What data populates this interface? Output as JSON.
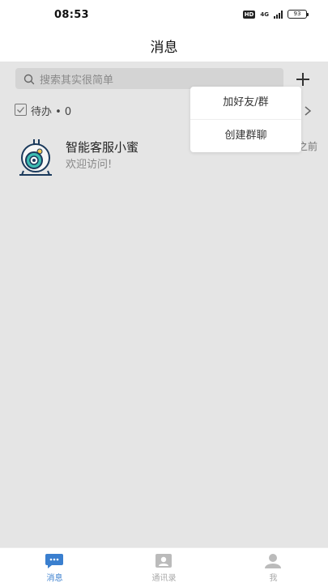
{
  "status_bar": {
    "time": "08:53",
    "hd": "HD",
    "network": "4G",
    "battery": "93"
  },
  "header": {
    "title": "消息"
  },
  "search": {
    "placeholder": "搜索其实很简单"
  },
  "todo": {
    "label": "待办 • 0"
  },
  "chats": [
    {
      "name": "智能客服小蜜",
      "preview": "欢迎访问!",
      "time": "之前"
    }
  ],
  "popup_menu": {
    "items": [
      {
        "label": "加好友/群"
      },
      {
        "label": "创建群聊"
      }
    ]
  },
  "tab_bar": {
    "tabs": [
      {
        "label": "消息",
        "icon": "chat-bubble-icon",
        "active": true
      },
      {
        "label": "通讯录",
        "icon": "contacts-icon",
        "active": false
      },
      {
        "label": "我",
        "icon": "person-icon",
        "active": false
      }
    ]
  },
  "colors": {
    "accent": "#3a7fcf",
    "background": "#e5e5e5",
    "inactive_tab": "#aaaaaa"
  }
}
